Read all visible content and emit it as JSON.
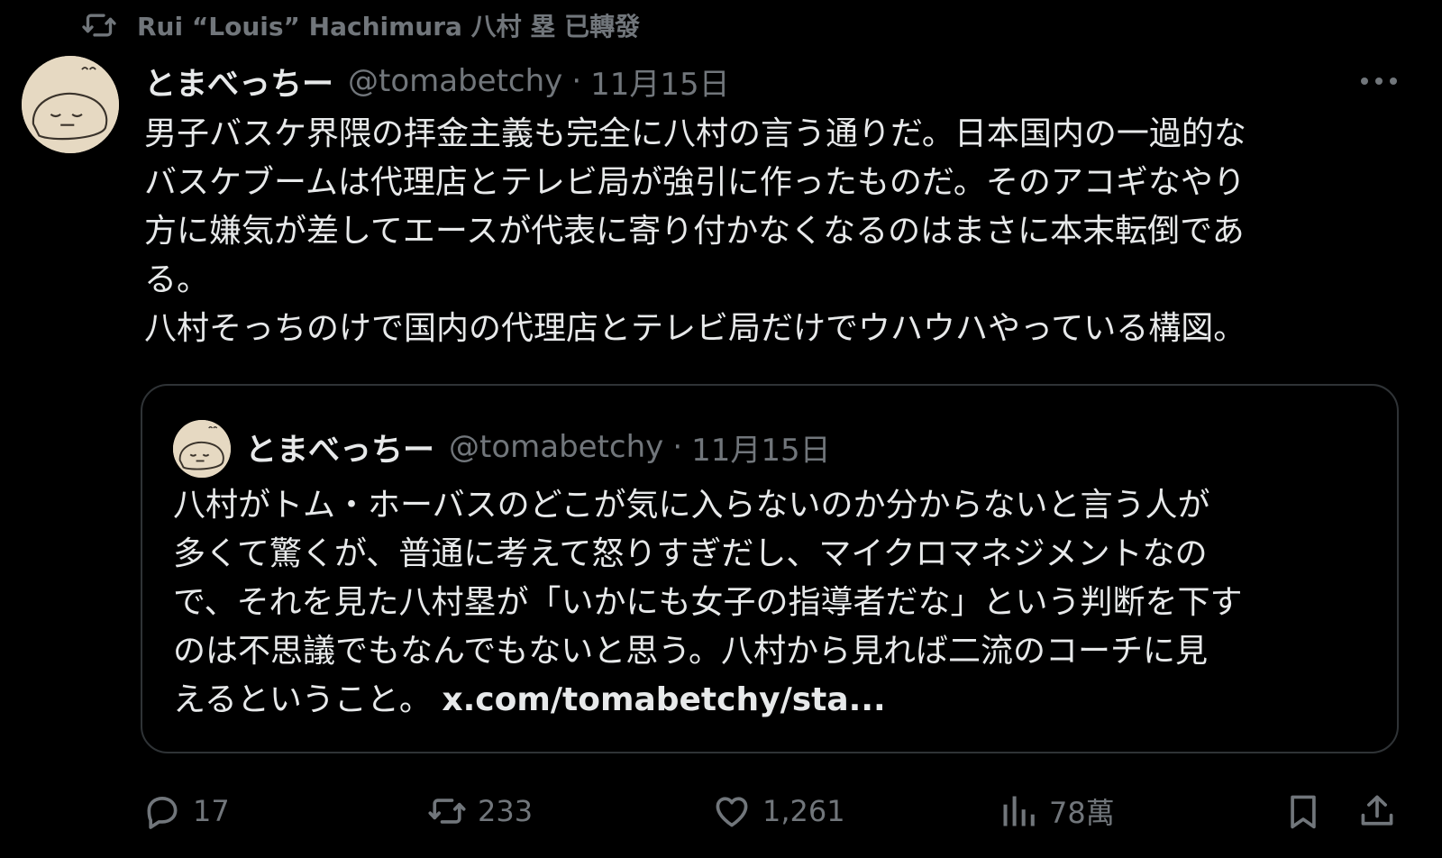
{
  "repost_header": {
    "icon": "repost-icon",
    "text": "Rui “Louis” Hachimura 八村 塁 已轉發"
  },
  "tweet": {
    "author": {
      "display_name": "とまべっちー",
      "handle": "@tomabetchy",
      "avatar_icon": "face-avatar"
    },
    "separator": "·",
    "date": "11月15日",
    "more_icon": "more-icon",
    "text_lines": [
      "男子バスケ界隈の拝金主義も完全に八村の言う通りだ。日本国内の一過的な",
      "バスケブームは代理店とテレビ局が強引に作ったものだ。そのアコギなやり",
      "方に嫌気が差してエースが代表に寄り付かなくなるのはまさに本末転倒であ",
      "る。",
      "八村そっちのけで国内の代理店とテレビ局だけでウハウハやっている構図。"
    ]
  },
  "quote": {
    "author": {
      "display_name": "とまべっちー",
      "handle": "@tomabetchy",
      "avatar_icon": "face-avatar"
    },
    "separator": "·",
    "date": "11月15日",
    "text_lines": [
      "八村がトム・ホーバスのどこが気に入らないのか分からないと言う人が",
      "多くて驚くが、普通に考えて怒りすぎだし、マイクロマネジメントなの",
      "で、それを見た八村塁が「いかにも女子の指導者だな」という判断を下す",
      "のは不思議でもなんでもないと思う。八村から見れば二流のコーチに見"
    ],
    "last_line_text": "えるということ。 ",
    "link_text": "x.com/tomabetchy/sta..."
  },
  "actions": {
    "reply": {
      "icon": "reply-icon",
      "count": "17"
    },
    "repost": {
      "icon": "repost-icon",
      "count": "233"
    },
    "like": {
      "icon": "heart-icon",
      "count": "1,261"
    },
    "views": {
      "icon": "views-chart-icon",
      "count": "78萬"
    },
    "bookmark": {
      "icon": "bookmark-icon"
    },
    "share": {
      "icon": "share-icon"
    }
  },
  "colors": {
    "background": "#000000",
    "text_primary": "#e7e9ea",
    "text_secondary": "#71767b",
    "border": "#2f3336",
    "avatar_bg": "#e6d9c2"
  }
}
